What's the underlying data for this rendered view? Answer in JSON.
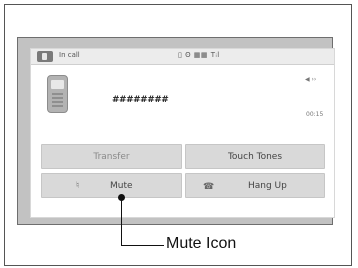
{
  "status_bar": {
    "label": "In call",
    "indicators": "▯ ʘ ▦▦ Tᵢl"
  },
  "call": {
    "number": "########",
    "volume": "◀ ››",
    "timer": "00:15"
  },
  "buttons": {
    "transfer": "Transfer",
    "touch_tones": "Touch Tones",
    "mute": "Mute",
    "hang_up": "Hang Up"
  },
  "icons": {
    "status_phone": "phone-icon",
    "handset": "handset-icon",
    "mute": "mute-icon",
    "hang_up": "hang-up-icon"
  },
  "callout": {
    "label": "Mute Icon"
  }
}
